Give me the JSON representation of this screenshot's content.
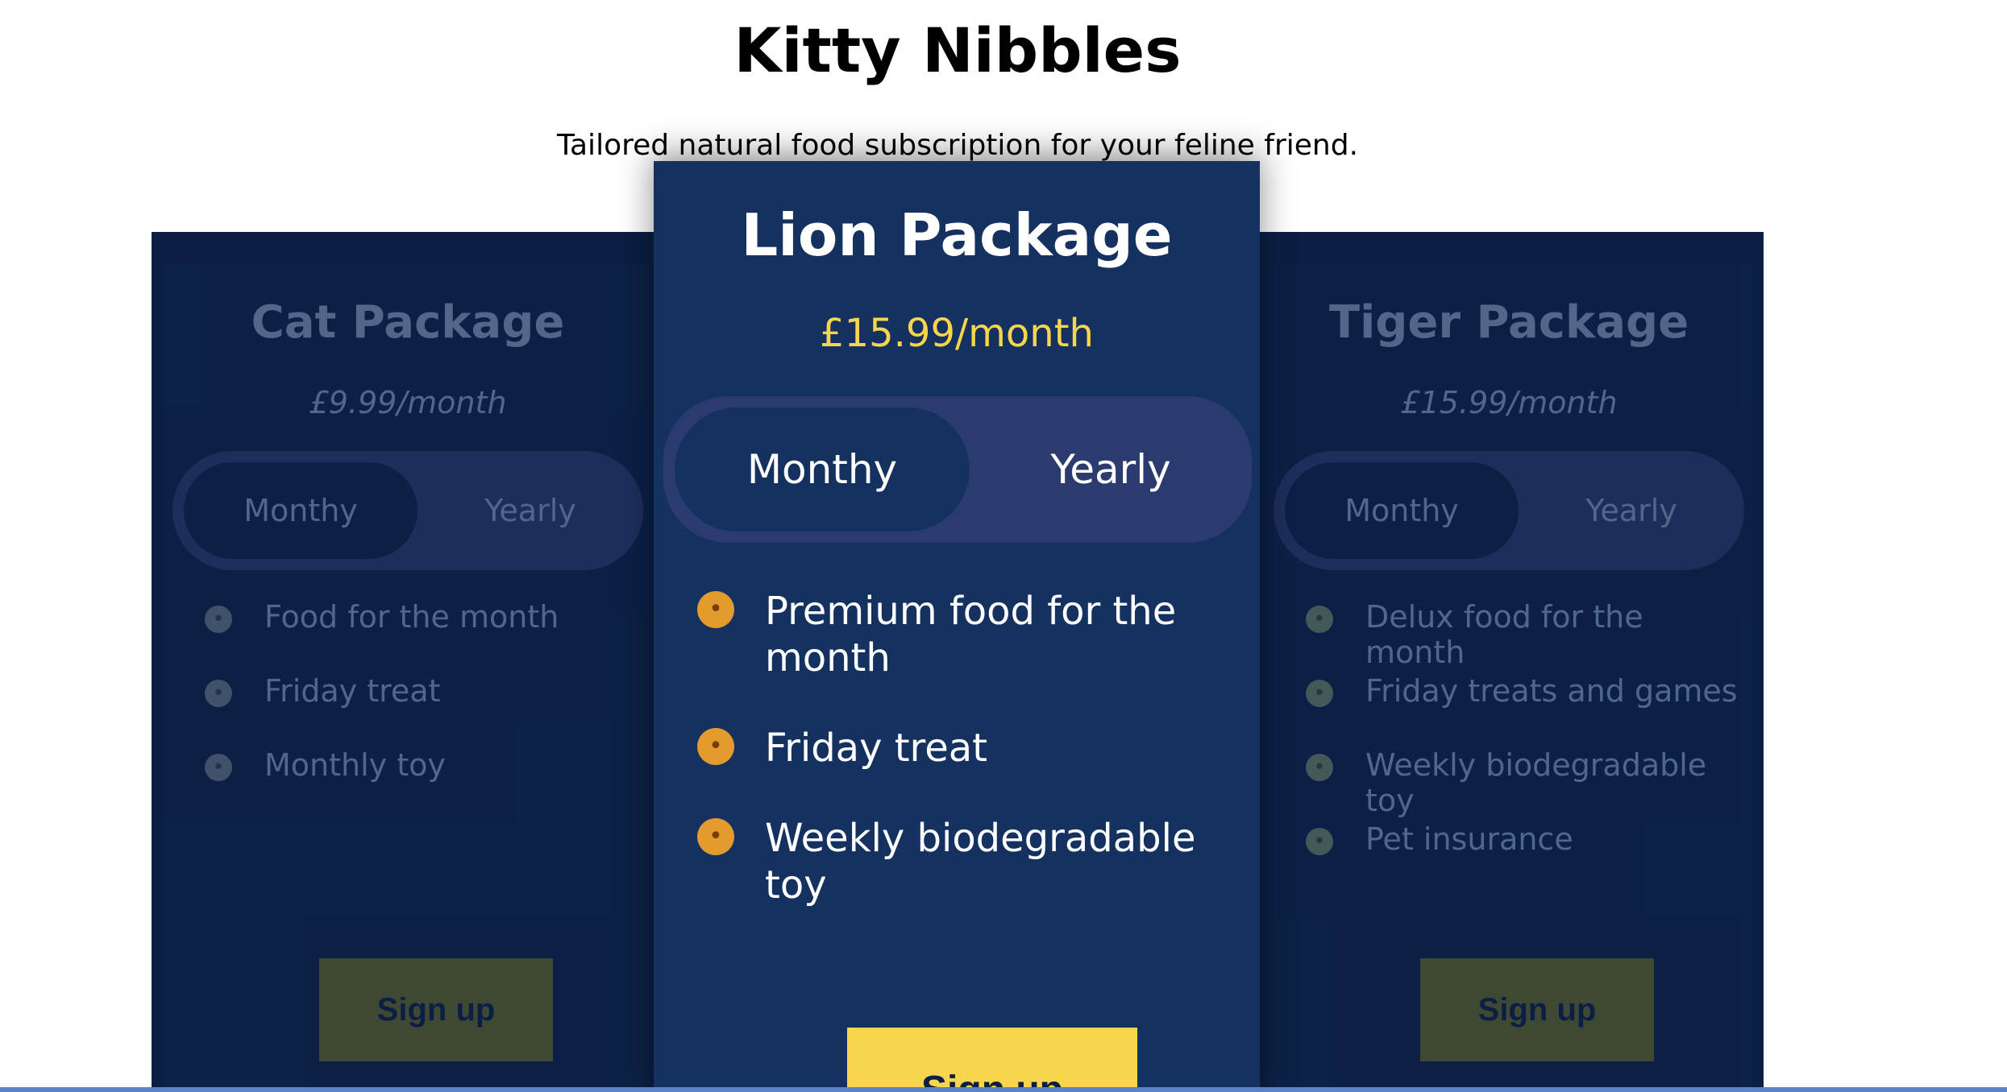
{
  "header": {
    "title": "Kitty Nibbles",
    "subtitle": "Tailored natural food subscription for your feline friend."
  },
  "cards": {
    "cat": {
      "title": "Cat Package",
      "price": "£9.99/month",
      "toggle": {
        "monthly": "Monthy",
        "yearly": "Yearly"
      },
      "features": [
        "Food for the month",
        "Friday treat",
        "Monthly toy"
      ],
      "button": "Sign up",
      "icon": "cat-face-icon"
    },
    "lion": {
      "title": "Lion Package",
      "price": "£15.99/month",
      "toggle": {
        "monthly": "Monthy",
        "yearly": "Yearly"
      },
      "features": [
        "Premium food for the month",
        "Friday treat",
        "Weekly biodegradable toy"
      ],
      "button": "Sign up",
      "icon": "lion-face-icon"
    },
    "tiger": {
      "title": "Tiger Package",
      "price": "£15.99/month",
      "toggle": {
        "monthly": "Monthy",
        "yearly": "Yearly"
      },
      "features": [
        "Delux food for the month",
        "Friday treats and games",
        "Weekly biodegradable toy",
        "Pet insurance"
      ],
      "button": "Sign up",
      "icon": "tiger-face-icon"
    }
  },
  "colors": {
    "panel": "#0b1f44",
    "featured_card": "#143160",
    "accent": "#f7d54c",
    "toggle_track": "#2c3b6f"
  }
}
